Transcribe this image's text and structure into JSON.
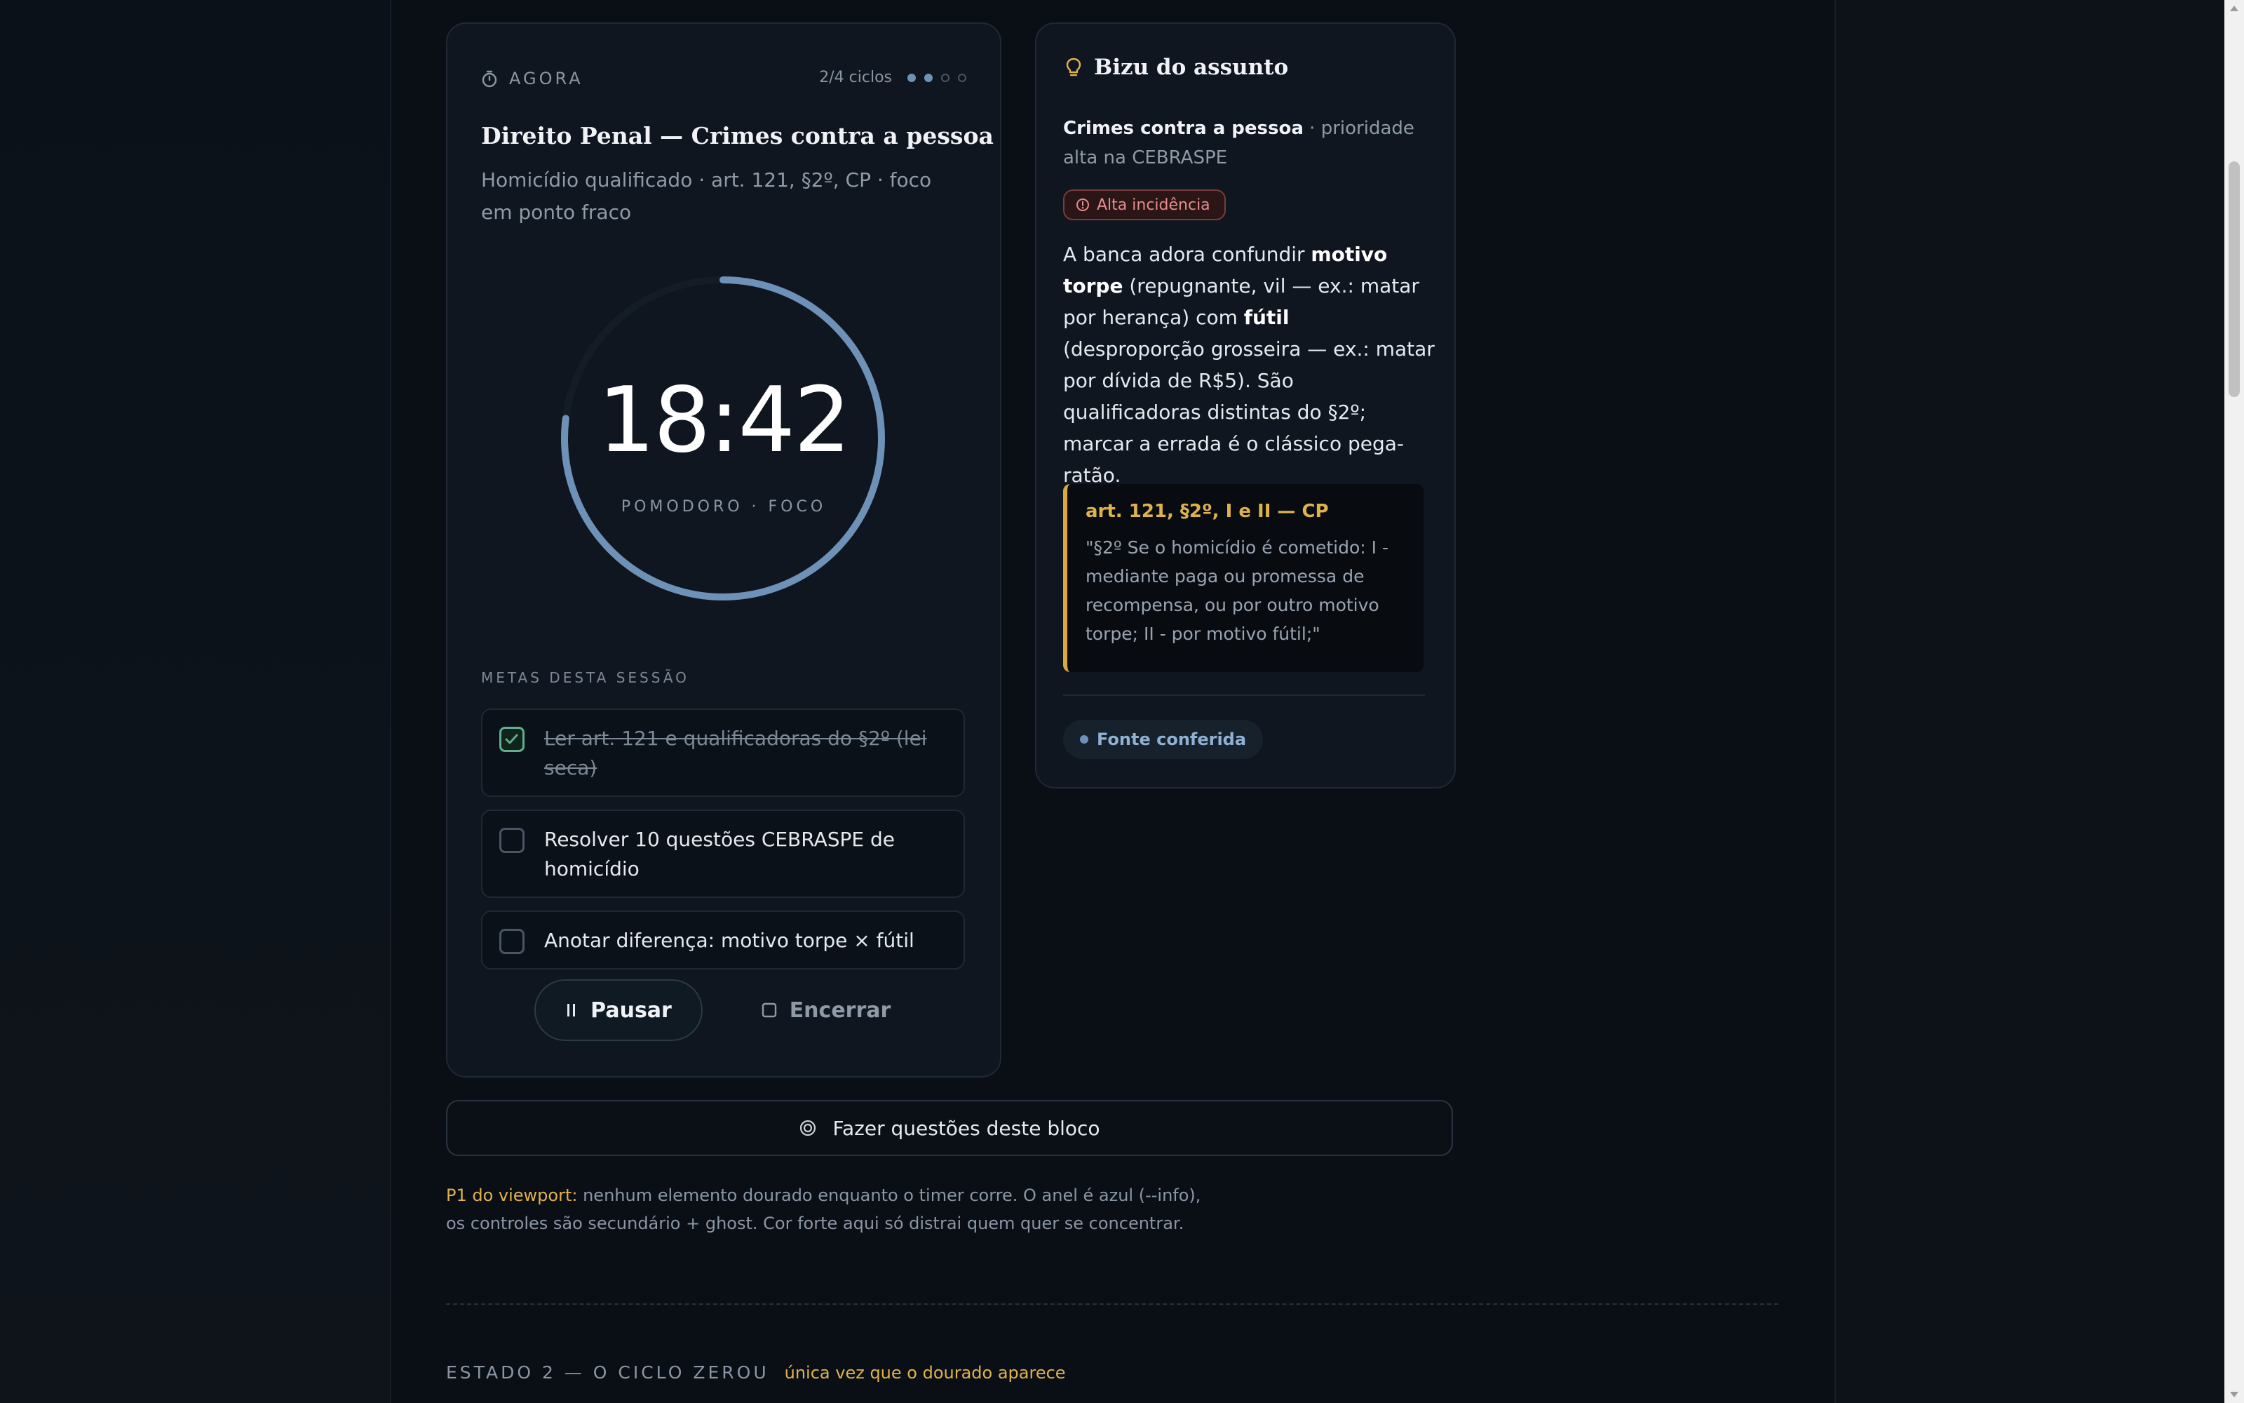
{
  "timer_card": {
    "now_label": "AGORA",
    "cycles_text": "2/4 ciclos",
    "cycles_done": 2,
    "cycles_total": 4,
    "subject": "Direito Penal — Crimes contra a pessoa",
    "detail": "Homicídio qualificado · art. 121, §2º, CP · foco em ponto fraco",
    "time": "18:42",
    "time_label": "POMODORO · FOCO",
    "progress_fraction": 0.77,
    "goals_title": "METAS DESTA SESSÃO",
    "goals": [
      {
        "label": "Ler art. 121 e qualificadoras do §2º (lei seca)",
        "checked": true
      },
      {
        "label": "Resolver 10 questões CEBRASPE de homicídio",
        "checked": false
      },
      {
        "label": "Anotar diferença: motivo torpe × fútil",
        "checked": false
      }
    ],
    "pause_label": "Pausar",
    "end_label": "Encerrar"
  },
  "bizu_card": {
    "title": "Bizu do assunto",
    "topic": "Crimes contra a pessoa",
    "topic_meta": " · prioridade alta na CEBRASPE",
    "badge": "Alta incidência",
    "body_1": "A banca adora confundir ",
    "body_b1": "motivo torpe",
    "body_2": " (repugnante, vil — ex.: matar por herança) com ",
    "body_b2": "fútil",
    "body_3": " (desproporção grosseira — ex.: matar por dívida de R$5). São qualificadoras distintas do §2º; marcar a errada é o clássico pega-ratão.",
    "quote_ref": "art. 121, §2º, I e II — CP",
    "quote_text": "\"§2º Se o homicídio é cometido: I - mediante paga ou promessa de recompensa, ou por outro motivo torpe; II - por motivo fútil;\"",
    "source_label": "Fonte conferida"
  },
  "action_bar": {
    "label": "Fazer questões deste bloco"
  },
  "note": {
    "highlight": "P1 do viewport:",
    "text": " nenhum elemento dourado enquanto o timer corre. O anel é azul (--info), os controles são secundário + ghost. Cor forte aqui só distrai quem quer se concentrar."
  },
  "section": {
    "title": "ESTADO 2 — O CICLO ZEROU",
    "subtitle": "única vez que o dourado aparece"
  },
  "colors": {
    "ring": "#6e91b7",
    "ring_track": "#141c26",
    "gold": "#e0b24a",
    "success": "#5fae8c",
    "danger": "#e58d8d"
  }
}
